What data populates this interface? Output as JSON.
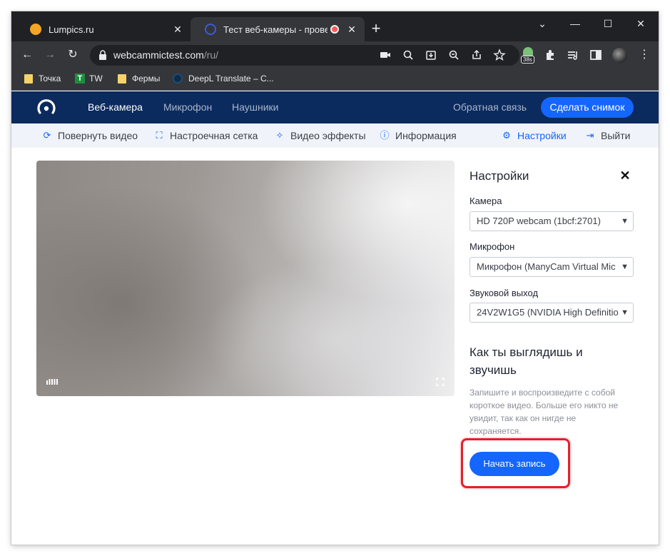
{
  "browser": {
    "tabs": [
      {
        "title": "Lumpics.ru",
        "favicon_color": "#f5a623"
      },
      {
        "title": "Тест веб-камеры - проверка",
        "favicon_color": "#3b5bdb"
      }
    ],
    "new_tab": "+",
    "window_controls": {
      "dropdown": "⌄",
      "minimize": "—",
      "maximize": "☐",
      "close": "✕"
    },
    "toolbar": {
      "back": "←",
      "forward": "→",
      "reload": "↻",
      "menu": "⋮"
    },
    "url_host": "webcammictest.com",
    "url_path": "/ru/",
    "extension_badge": "38s"
  },
  "bookmarks": [
    {
      "label": "Точка",
      "icon": "folder-icon"
    },
    {
      "label": "TW",
      "icon": "tw-icon",
      "glyph": "T"
    },
    {
      "label": "Фермы",
      "icon": "folder-icon"
    },
    {
      "label": "DeepL Translate – C...",
      "icon": "deepl-icon"
    }
  ],
  "site_nav": {
    "links": [
      "Веб-камера",
      "Микрофон",
      "Наушники"
    ],
    "feedback": "Обратная связь",
    "snapshot_button": "Сделать снимок"
  },
  "sub_nav": {
    "rotate": "Повернуть видео",
    "grid": "Настроечная сетка",
    "effects": "Видео эффекты",
    "info": "Информация",
    "settings": "Настройки",
    "exit": "Выйти"
  },
  "settings": {
    "title": "Настройки",
    "close": "✕",
    "camera_label": "Камера",
    "camera_value": "HD 720P webcam (1bcf:2701)",
    "mic_label": "Микрофон",
    "mic_value": "Микрофон (ManyCam Virtual Mic",
    "output_label": "Звуковой выход",
    "output_value": "24V2W1G5 (NVIDIA High Definitio",
    "how_title": "Как ты выглядишь и звучишь",
    "how_desc": "Запишите и воспроизведите с собой короткое видео. Больше его никто не увидит, так как он нигде не сохраняется.",
    "record_button": "Начать запись"
  },
  "colors": {
    "site_nav_bg": "#0b2a5e",
    "accent": "#1565ff",
    "highlight": "#e4202a"
  }
}
